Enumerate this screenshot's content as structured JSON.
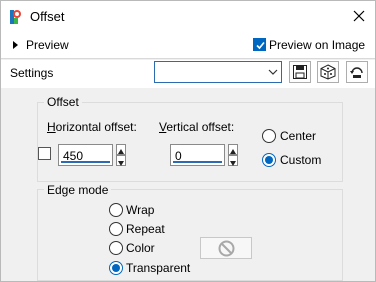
{
  "window": {
    "title": "Offset"
  },
  "preview": {
    "label": "Preview",
    "preview_on_image_label": "Preview on Image",
    "preview_on_image_checked": true
  },
  "settings": {
    "label": "Settings",
    "preset_value": ""
  },
  "offset_group": {
    "title": "Offset",
    "horizontal_label": "Horizontal offset:",
    "horizontal_value": "450",
    "vertical_label": "Vertical offset:",
    "vertical_value": "0",
    "link_checked": false,
    "options": [
      {
        "label": "Center",
        "selected": false
      },
      {
        "label": "Custom",
        "selected": true
      }
    ]
  },
  "edge_group": {
    "title": "Edge mode",
    "options": [
      {
        "label": "Wrap",
        "selected": false
      },
      {
        "label": "Repeat",
        "selected": false
      },
      {
        "label": "Color",
        "selected": false
      },
      {
        "label": "Transparent",
        "selected": true
      }
    ]
  },
  "icons": [
    "app-icon",
    "close-icon",
    "expand-arrow-icon",
    "dropdown-chevron-icon",
    "save-preset-icon",
    "randomize-icon",
    "reset-icon",
    "disabled-color-icon"
  ],
  "colors": {
    "accent": "#0067c0",
    "progress": "#2d6ab4"
  }
}
